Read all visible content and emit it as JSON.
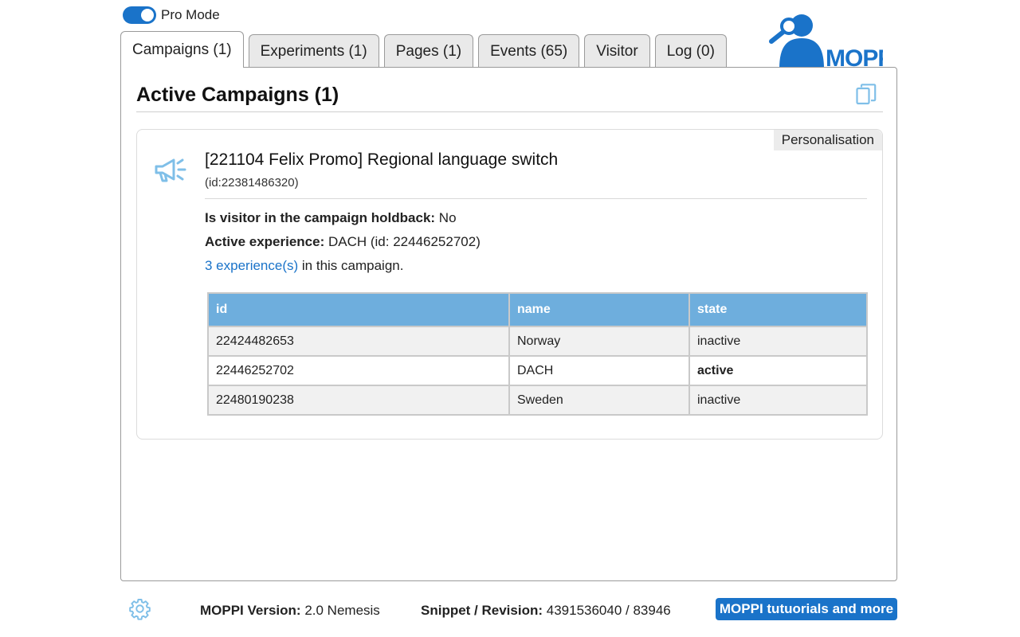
{
  "pro_mode": {
    "label": "Pro Mode",
    "enabled": true
  },
  "tabs": [
    {
      "label": "Campaigns (1)",
      "active": true
    },
    {
      "label": "Experiments (1)",
      "active": false
    },
    {
      "label": "Pages (1)",
      "active": false
    },
    {
      "label": "Events (65)",
      "active": false
    },
    {
      "label": "Visitor",
      "active": false
    },
    {
      "label": "Log (0)",
      "active": false
    }
  ],
  "logo": {
    "text": "MOPPI"
  },
  "panel": {
    "title": "Active Campaigns (1)",
    "copy_icon": "copy-icon"
  },
  "campaign": {
    "badge": "Personalisation",
    "icon": "megaphone-icon",
    "title": "[221104 Felix Promo] Regional language switch",
    "id_text": "(id:22381486320)",
    "holdback_label": "Is visitor in the campaign holdback:",
    "holdback_value": " No",
    "active_exp_label": "Active experience:",
    "active_exp_value": " DACH (id: 22446252702)",
    "experiences_link": "3 experience(s)",
    "experiences_suffix": " in this campaign.",
    "table": {
      "headers": [
        "id",
        "name",
        "state"
      ],
      "rows": [
        {
          "id": "22424482653",
          "name": "Norway",
          "state": "inactive"
        },
        {
          "id": "22446252702",
          "name": "DACH",
          "state": "active"
        },
        {
          "id": "22480190238",
          "name": "Sweden",
          "state": "inactive"
        }
      ]
    }
  },
  "footer": {
    "settings_icon": "gear-icon",
    "version_label": "MOPPI Version:",
    "version_value": " 2.0 Nemesis",
    "snippet_label": "Snippet / Revision:",
    "snippet_value": " 4391536040 / 83946",
    "tutorials_button": "MOPPI tutuorials and more"
  },
  "colors": {
    "accent": "#1a73c9",
    "table_header": "#6eaedd",
    "icon_light_blue": "#7fbfe8"
  }
}
